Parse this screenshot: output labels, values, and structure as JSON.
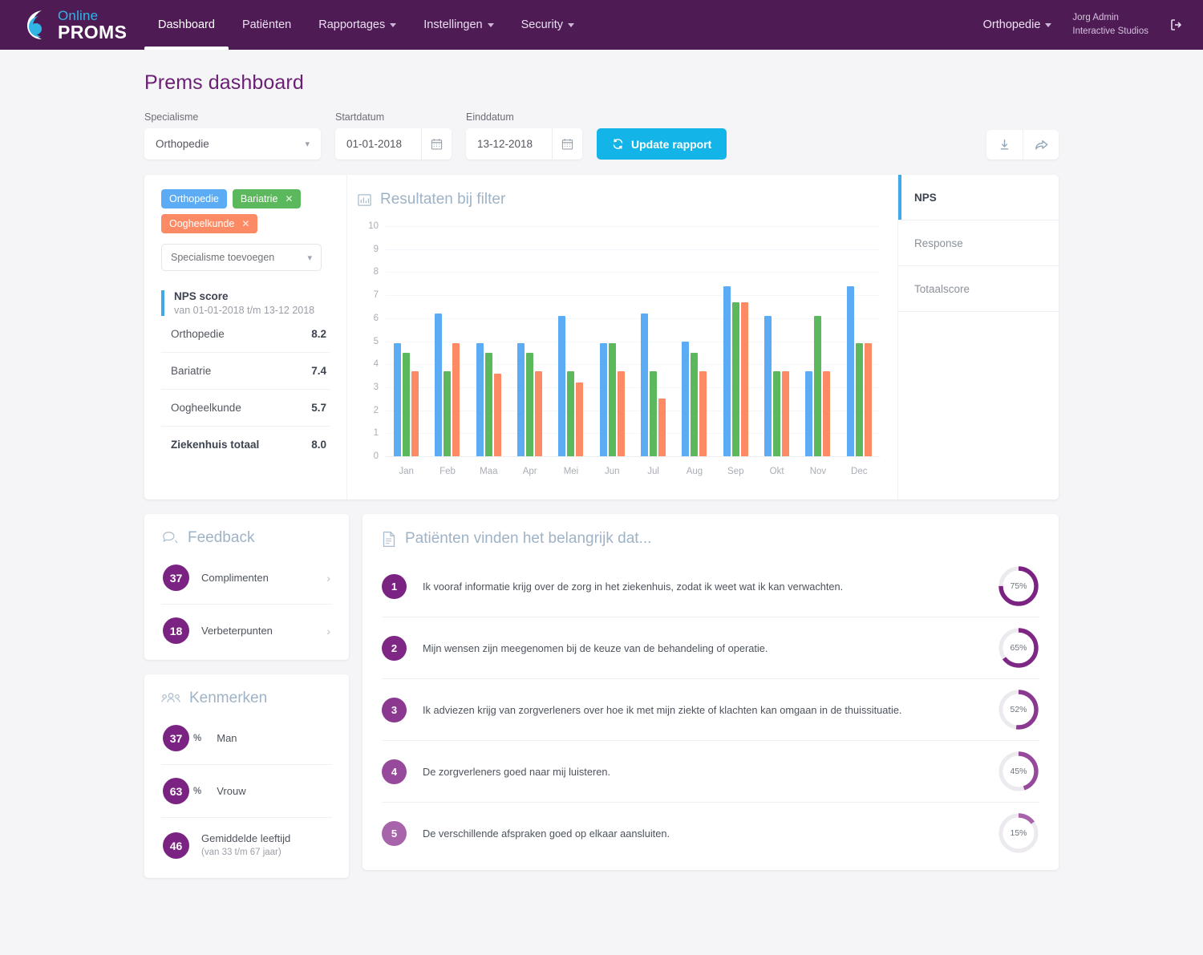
{
  "nav": {
    "brand": {
      "line1": "Online",
      "line2": "PROMS",
      "logo_icon": "proms-logo-icon"
    },
    "items": [
      {
        "label": "Dashboard",
        "active": true,
        "caret": false
      },
      {
        "label": "Patiënten",
        "active": false,
        "caret": false
      },
      {
        "label": "Rapportages",
        "active": false,
        "caret": true
      },
      {
        "label": "Instellingen",
        "active": false,
        "caret": true
      },
      {
        "label": "Security",
        "active": false,
        "caret": true
      }
    ],
    "specialty_selector": "Orthopedie",
    "user_name": "Jorg Admin",
    "user_org": "Interactive Studios",
    "logout_icon": "logout-icon"
  },
  "page": {
    "title": "Prems dashboard"
  },
  "filters": {
    "specialisme_label": "Specialisme",
    "specialisme_value": "Orthopedie",
    "startdatum_label": "Startdatum",
    "startdatum_value": "01-01-2018",
    "einddatum_label": "Einddatum",
    "einddatum_value": "13-12-2018",
    "update_button": "Update rapport",
    "update_icon": "refresh-icon",
    "calendar_icon": "calendar-icon",
    "download_icon": "download-icon",
    "share_icon": "share-icon"
  },
  "left_panel": {
    "chips": [
      {
        "label": "Orthopedie",
        "color": "#5BACF5",
        "removable": false
      },
      {
        "label": "Bariatrie",
        "color": "#5CB85C",
        "removable": true
      },
      {
        "label": "Oogheelkunde",
        "color": "#FC8A65",
        "removable": true
      }
    ],
    "add_select_placeholder": "Specialisme toevoegen",
    "nps_title": "NPS score",
    "nps_subtitle": "van 01-01-2018 t/m 13-12 2018",
    "scores": [
      {
        "label": "Orthopedie",
        "value": "8.2",
        "bold": false
      },
      {
        "label": "Bariatrie",
        "value": "7.4",
        "bold": false
      },
      {
        "label": "Oogheelkunde",
        "value": "5.7",
        "bold": false
      },
      {
        "label": "Ziekenhuis totaal",
        "value": "8.0",
        "bold": true
      }
    ]
  },
  "chart_panel": {
    "title": "Resultaten bij filter",
    "icon": "bar-chart-icon",
    "tabs": [
      {
        "label": "NPS",
        "active": true
      },
      {
        "label": "Response",
        "active": false
      },
      {
        "label": "Totaalscore",
        "active": false
      }
    ]
  },
  "chart_data": {
    "type": "bar",
    "title": "Resultaten bij filter",
    "xlabel": "",
    "ylabel": "",
    "ylim": [
      0,
      10
    ],
    "yticks": [
      0,
      1,
      2,
      3,
      4,
      5,
      6,
      7,
      8,
      9,
      10
    ],
    "grid": true,
    "legend": "none",
    "categories": [
      "Jan",
      "Feb",
      "Maa",
      "Apr",
      "Mei",
      "Jun",
      "Jul",
      "Aug",
      "Sep",
      "Okt",
      "Nov",
      "Dec"
    ],
    "series": [
      {
        "name": "Orthopedie",
        "color": "#5BACF5",
        "values": [
          4.9,
          6.2,
          4.9,
          4.9,
          6.1,
          4.9,
          6.2,
          5.0,
          7.4,
          6.1,
          3.7,
          7.4
        ]
      },
      {
        "name": "Bariatrie",
        "color": "#5CB85C",
        "values": [
          4.5,
          3.7,
          4.5,
          4.5,
          3.7,
          4.9,
          3.7,
          4.5,
          6.7,
          3.7,
          6.1,
          4.9
        ]
      },
      {
        "name": "Oogheelkunde",
        "color": "#FC8A65",
        "values": [
          3.7,
          4.9,
          3.6,
          3.7,
          3.2,
          3.7,
          2.5,
          3.7,
          6.7,
          3.7,
          3.7,
          4.9
        ]
      }
    ]
  },
  "feedback": {
    "title": "Feedback",
    "icon": "chat-bubble-icon",
    "items": [
      {
        "count": "37",
        "label": "Complimenten"
      },
      {
        "count": "18",
        "label": "Verbeterpunten"
      }
    ]
  },
  "kenmerken": {
    "title": "Kenmerken",
    "icon": "people-icon",
    "items": [
      {
        "value": "37",
        "unit": "%",
        "label": "Man",
        "sub": ""
      },
      {
        "value": "63",
        "unit": "%",
        "label": "Vrouw",
        "sub": ""
      },
      {
        "value": "46",
        "unit": "",
        "label": "Gemiddelde leeftijd",
        "sub": "(van 33 t/m 67 jaar)"
      }
    ]
  },
  "questions": {
    "title": "Patiënten vinden het belangrijk dat...",
    "icon": "document-icon",
    "items": [
      {
        "num": "1",
        "text": "Ik vooraf informatie krijg over de zorg in het ziekenhuis, zodat ik weet wat ik kan verwachten.",
        "percent": 75,
        "percent_label": "75%",
        "num_color": "#7B2382",
        "ring_color": "#7B2382"
      },
      {
        "num": "2",
        "text": "Mijn wensen zijn meegenomen bij de keuze van de behandeling of operatie.",
        "percent": 65,
        "percent_label": "65%",
        "num_color": "#7E2785",
        "ring_color": "#7E2785"
      },
      {
        "num": "3",
        "text": "Ik adviezen krijg van zorgverleners over hoe ik met mijn ziekte of klachten kan omgaan in de thuissituatie.",
        "percent": 52,
        "percent_label": "52%",
        "num_color": "#8B3890",
        "ring_color": "#8B3890"
      },
      {
        "num": "4",
        "text": "De zorgverleners goed naar mij luisteren.",
        "percent": 45,
        "percent_label": "45%",
        "num_color": "#97499C",
        "ring_color": "#97499C"
      },
      {
        "num": "5",
        "text": "De verschillende afspraken goed op elkaar aansluiten.",
        "percent": 15,
        "percent_label": "15%",
        "num_color": "#A764AB",
        "ring_color": "#A764AB"
      }
    ]
  }
}
